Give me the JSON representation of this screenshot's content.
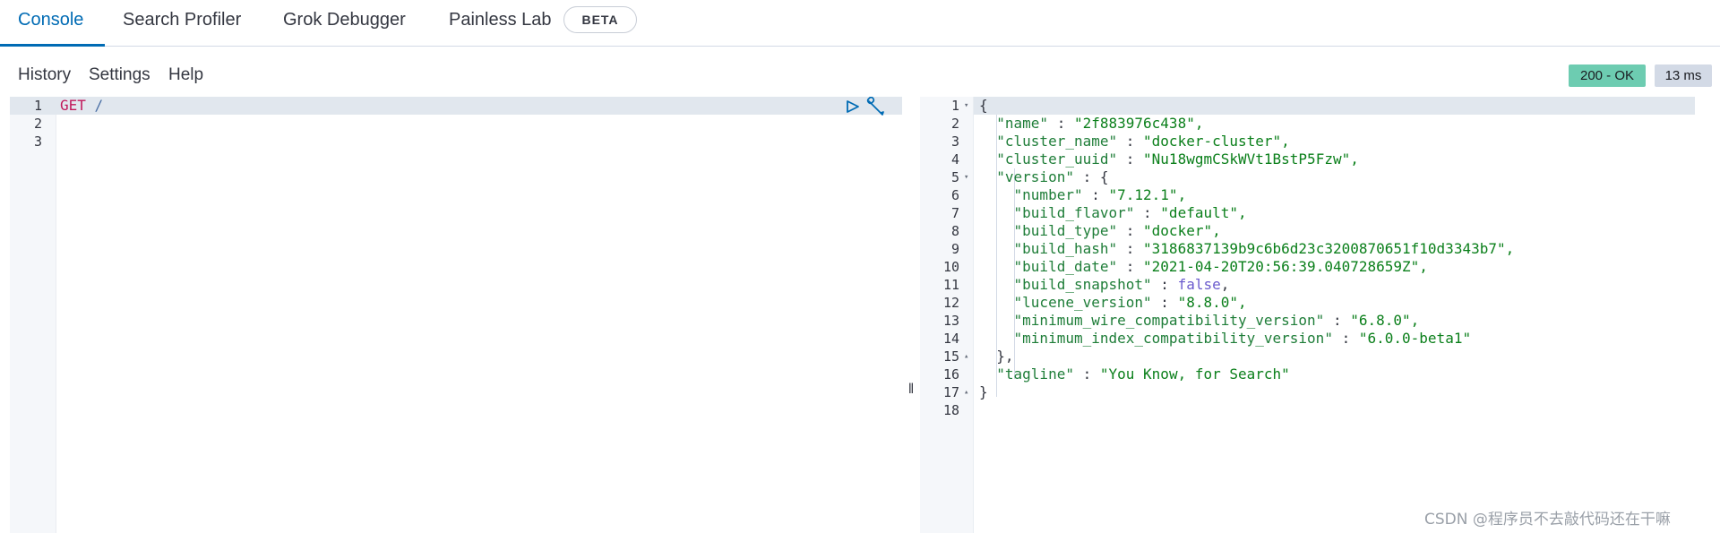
{
  "tabs": [
    {
      "label": "Console"
    },
    {
      "label": "Search Profiler"
    },
    {
      "label": "Grok Debugger"
    },
    {
      "label": "Painless Lab"
    }
  ],
  "beta_badge": "BETA",
  "menu": {
    "history": "History",
    "settings": "Settings",
    "help": "Help"
  },
  "status": {
    "code": "200 - OK",
    "time": "13 ms"
  },
  "request_editor": {
    "line_numbers": [
      "1",
      "2",
      "3"
    ],
    "method": "GET",
    "path": "/"
  },
  "response_editor": {
    "line_numbers": [
      "1",
      "2",
      "3",
      "4",
      "5",
      "6",
      "7",
      "8",
      "9",
      "10",
      "11",
      "12",
      "13",
      "14",
      "15",
      "16",
      "17",
      "18"
    ],
    "lines": {
      "l1": "{",
      "l2k": "\"name\"",
      "l2v": "\"2f883976c438\",",
      "l3k": "\"cluster_name\"",
      "l3v": "\"docker-cluster\",",
      "l4k": "\"cluster_uuid\"",
      "l4v": "\"Nu18wgmCSkWVt1BstP5Fzw\",",
      "l5k": "\"version\"",
      "l5v": "{",
      "l6k": "\"number\"",
      "l6v": "\"7.12.1\",",
      "l7k": "\"build_flavor\"",
      "l7v": "\"default\",",
      "l8k": "\"build_type\"",
      "l8v": "\"docker\",",
      "l9k": "\"build_hash\"",
      "l9v": "\"3186837139b9c6b6d23c3200870651f10d3343b7\",",
      "l10k": "\"build_date\"",
      "l10v": "\"2021-04-20T20:56:39.040728659Z\",",
      "l11k": "\"build_snapshot\"",
      "l11v": "false",
      "l12k": "\"lucene_version\"",
      "l12v": "\"8.8.0\",",
      "l13k": "\"minimum_wire_compatibility_version\"",
      "l13v": "\"6.8.0\",",
      "l14k": "\"minimum_index_compatibility_version\"",
      "l14v": "\"6.0.0-beta1\"",
      "l15": "},",
      "l16k": "\"tagline\"",
      "l16v": "\"You Know, for Search\"",
      "l17": "}"
    }
  },
  "watermark": "CSDN @程序员不去敲代码还在干嘛",
  "colors": {
    "accent": "#006bb4",
    "status_ok": "#6dccb1",
    "time_badge": "#d3dae6",
    "json_key": "#1e7d38",
    "json_string": "#0a7f1a",
    "json_keyword": "#6a5acd",
    "http_method": "#c1185b"
  },
  "icons": {
    "run": "play-icon",
    "settings": "wrench-icon"
  }
}
